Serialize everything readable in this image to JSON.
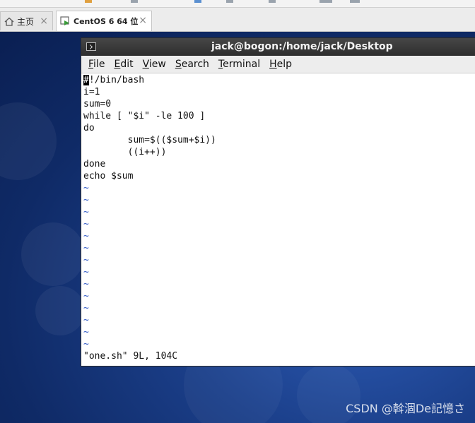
{
  "tabs": [
    {
      "label": "主页",
      "icon": "home-icon",
      "active": false
    },
    {
      "label": "CentOS 6 64 位",
      "icon": "vm-icon",
      "active": true
    }
  ],
  "terminal": {
    "title": "jack@bogon:/home/jack/Desktop",
    "menu": [
      {
        "label": "File",
        "mnemonic": "F",
        "rest": "ile"
      },
      {
        "label": "Edit",
        "mnemonic": "E",
        "rest": "dit"
      },
      {
        "label": "View",
        "mnemonic": "V",
        "rest": "iew"
      },
      {
        "label": "Search",
        "mnemonic": "S",
        "rest": "earch"
      },
      {
        "label": "Terminal",
        "mnemonic": "T",
        "rest": "erminal"
      },
      {
        "label": "Help",
        "mnemonic": "H",
        "rest": "elp"
      }
    ],
    "first_line_cursor_char": "#",
    "first_line_rest": "!/bin/bash",
    "lines": [
      "i=1",
      "sum=0",
      "while [ \"$i\" -le 100 ]",
      "do",
      "        sum=$(($sum+$i))",
      "        ((i++))",
      "done",
      "echo $sum"
    ],
    "tilde": "~",
    "tilde_count": 14,
    "status": "\"one.sh\" 9L, 104C"
  },
  "watermark": "CSDN @斡涸De記憶さ",
  "colors": {
    "desktop": "#1b3f8a",
    "titlebar": "#3a3a3a",
    "tilde": "#2b55c4"
  }
}
